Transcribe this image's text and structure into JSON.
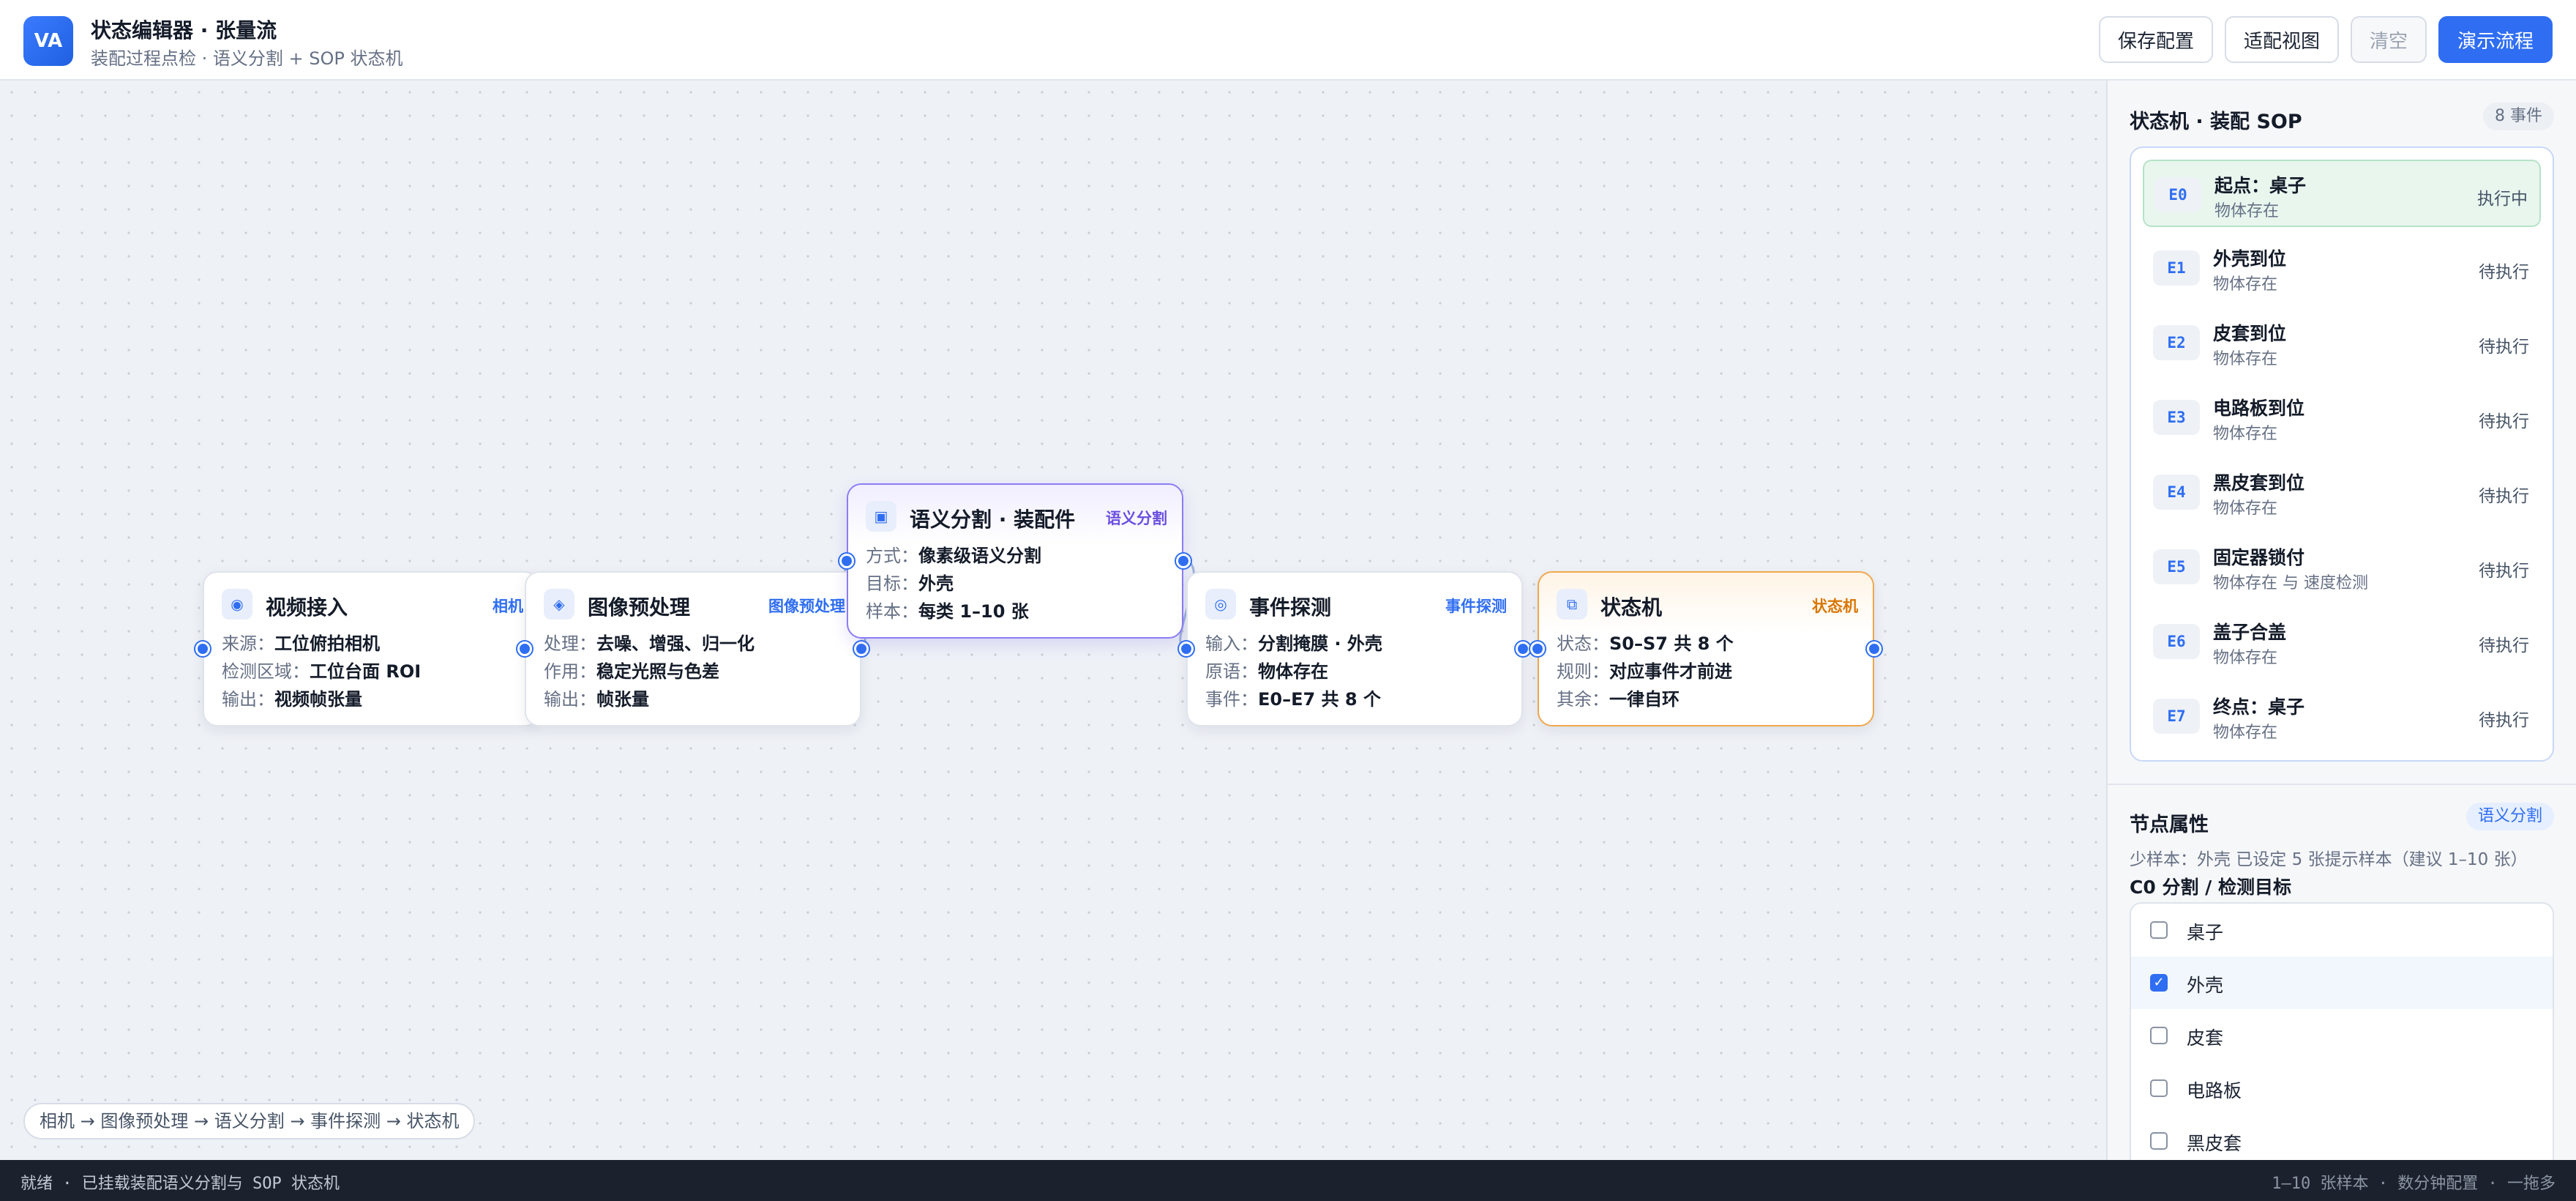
{
  "header": {
    "logo_text": "VA",
    "title": "状态编辑器 · 张量流",
    "subtitle": "装配过程点检 · 语义分割 + SOP 状态机",
    "buttons": {
      "save": "保存配置",
      "fit": "适配视图",
      "clear": "清空",
      "demo": "演示流程"
    }
  },
  "canvas": {
    "nodes": [
      {
        "title": "视频接入",
        "tag": "相机",
        "icon": "camera-icon",
        "rows": [
          {
            "k": "来源：",
            "v": "工位俯拍相机"
          },
          {
            "k": "检测区域：",
            "v": "工位台面 ROI"
          },
          {
            "k": "输出：",
            "v": "视频帧张量"
          }
        ]
      },
      {
        "title": "图像预处理",
        "tag": "图像预处理",
        "icon": "diamond-icon",
        "rows": [
          {
            "k": "处理：",
            "v": "去噪、增强、归一化"
          },
          {
            "k": "作用：",
            "v": "稳定光照与色差"
          },
          {
            "k": "输出：",
            "v": "帧张量"
          }
        ]
      },
      {
        "title": "语义分割 · 装配件",
        "tag": "语义分割",
        "icon": "segment-icon",
        "rows": [
          {
            "k": "方式：",
            "v": "像素级语义分割"
          },
          {
            "k": "目标：",
            "v": "外壳"
          },
          {
            "k": "样本：",
            "v": "每类 1–10 张"
          }
        ]
      },
      {
        "title": "事件探测",
        "tag": "事件探测",
        "icon": "eye-icon",
        "rows": [
          {
            "k": "输入：",
            "v": "分割掩膜 · 外壳"
          },
          {
            "k": "原语：",
            "v": "物体存在"
          },
          {
            "k": "事件：",
            "v": "E0–E7 共 8 个"
          }
        ]
      },
      {
        "title": "状态机",
        "tag": "状态机",
        "icon": "state-machine-icon",
        "rows": [
          {
            "k": "状态：",
            "v": "S0–S7 共 8 个"
          },
          {
            "k": "规则：",
            "v": "对应事件才前进"
          },
          {
            "k": "其余：",
            "v": "一律自环"
          }
        ]
      }
    ],
    "pipeline": "相机 → 图像预处理 → 语义分割 → 事件探测 → 状态机"
  },
  "panel": {
    "sm_title": "状态机 · 装配 SOP",
    "sm_count": "8 事件",
    "events": [
      {
        "code": "E0",
        "title": "起点：桌子",
        "sub": "物体存在",
        "status": "执行中",
        "active": true
      },
      {
        "code": "E1",
        "title": "外壳到位",
        "sub": "物体存在",
        "status": "待执行",
        "active": false
      },
      {
        "code": "E2",
        "title": "皮套到位",
        "sub": "物体存在",
        "status": "待执行",
        "active": false
      },
      {
        "code": "E3",
        "title": "电路板到位",
        "sub": "物体存在",
        "status": "待执行",
        "active": false
      },
      {
        "code": "E4",
        "title": "黑皮套到位",
        "sub": "物体存在",
        "status": "待执行",
        "active": false
      },
      {
        "code": "E5",
        "title": "固定器锁付",
        "sub": "物体存在 与 速度检测",
        "status": "待执行",
        "active": false
      },
      {
        "code": "E6",
        "title": "盖子合盖",
        "sub": "物体存在",
        "status": "待执行",
        "active": false
      },
      {
        "code": "E7",
        "title": "终点：桌子",
        "sub": "物体存在",
        "status": "待执行",
        "active": false
      }
    ],
    "props_title": "节点属性",
    "props_tag": "语义分割",
    "props_desc": "少样本：外壳 已设定 5 张提示样本（建议 1–10 张）",
    "targets_label": "C0 分割 / 检测目标",
    "targets": [
      {
        "label": "桌子",
        "checked": false
      },
      {
        "label": "外壳",
        "checked": true
      },
      {
        "label": "皮套",
        "checked": false
      },
      {
        "label": "电路板",
        "checked": false
      },
      {
        "label": "黑皮套",
        "checked": false
      }
    ]
  },
  "statusbar": {
    "left": "就绪 · 已挂载装配语义分割与 SOP 状态机",
    "right": "1–10 张样本 · 数分钟配置 · 一拖多"
  },
  "colors": {
    "accent": "#2f6ef2",
    "segment": "#8b7cf6",
    "state_machine": "#f0a74d",
    "active_event": "#e8f6ee"
  }
}
